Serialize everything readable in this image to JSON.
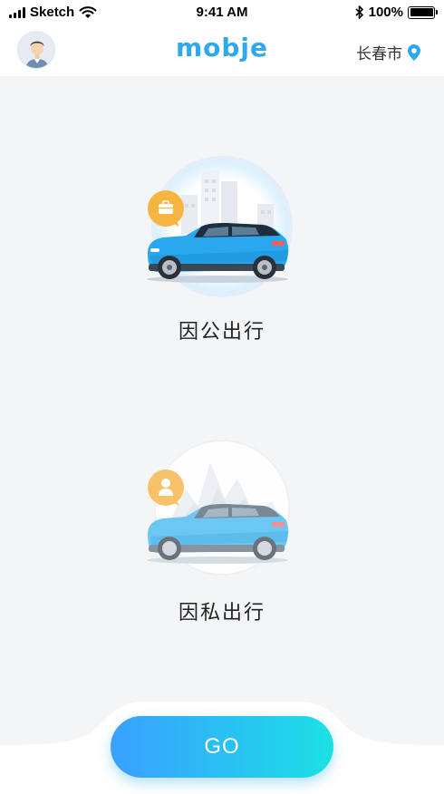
{
  "status_bar": {
    "carrier": "Sketch",
    "time": "9:41 AM",
    "battery": "100%",
    "battery_level": 1.0
  },
  "nav": {
    "brand": "mobje",
    "city": "长春市"
  },
  "options": [
    {
      "label": "因公出行",
      "badge_icon": "briefcase-icon"
    },
    {
      "label": "因私出行",
      "badge_icon": "person-icon"
    }
  ],
  "go_button": {
    "label": "GO"
  },
  "colors": {
    "accent": "#2fa8ee",
    "badge": "#f6b540",
    "car_primary": "#29a8f0",
    "car_secondary": "#6cc7f3",
    "go_gradient_start": "#3aa0ff",
    "go_gradient_end": "#1ce0e4"
  }
}
